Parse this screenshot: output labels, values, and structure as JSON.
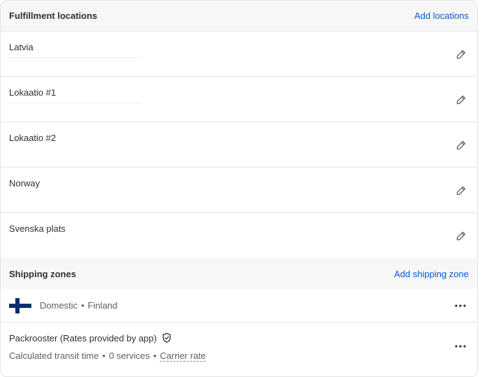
{
  "fulfillment": {
    "title": "Fulfillment locations",
    "add_label": "Add locations",
    "locations": [
      {
        "name": "Latvia"
      },
      {
        "name": "Lokaatio #1"
      },
      {
        "name": "Lokaatio #2"
      },
      {
        "name": "Norway"
      },
      {
        "name": "Svenska plats"
      }
    ]
  },
  "shipping": {
    "title": "Shipping zones",
    "add_label": "Add shipping zone",
    "zone": {
      "type": "Domestic",
      "separator": "•",
      "country": "Finland",
      "flag_icon": "finland-flag-icon"
    },
    "rate": {
      "title": "Packrooster (Rates provided by app)",
      "badge_icon": "shield-check-icon",
      "transit": "Calculated transit time",
      "services": "0 services",
      "carrier_label": "Carrier rate",
      "separator": "•"
    }
  },
  "colors": {
    "link": "#005bd3",
    "header_bg": "#f7f7f7",
    "border": "#e3e3e3",
    "flag_blue": "#002f6c"
  }
}
